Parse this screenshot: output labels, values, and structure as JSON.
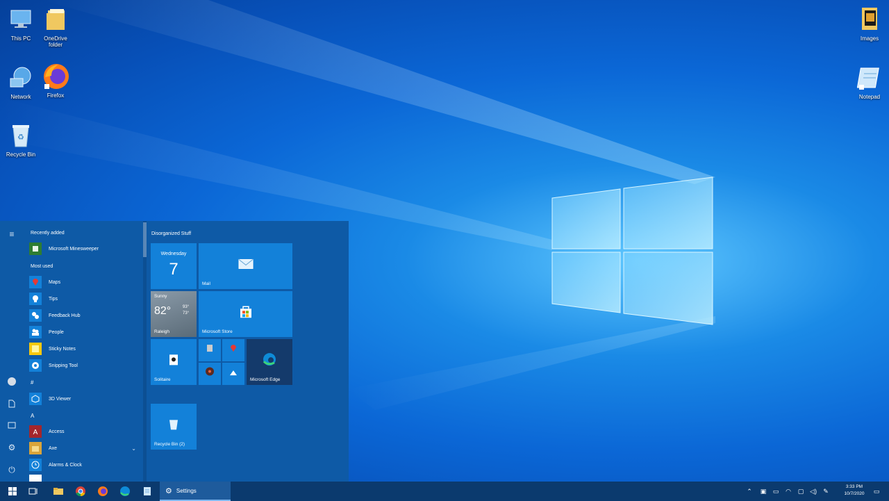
{
  "desktop": {
    "icons_left": [
      {
        "name": "this-pc",
        "label": "This PC"
      },
      {
        "name": "onedrive",
        "label": "OneDrive\nfolder"
      },
      {
        "name": "network",
        "label": "Network"
      },
      {
        "name": "firefox",
        "label": "Firefox"
      },
      {
        "name": "recycle-bin",
        "label": "Recycle Bin"
      }
    ],
    "icons_right": [
      {
        "name": "images",
        "label": "Images"
      },
      {
        "name": "notepad",
        "label": "Notepad"
      }
    ]
  },
  "start_menu": {
    "recently_added_header": "Recently added",
    "most_used_header": "Most used",
    "letter_hash": "#",
    "letter_a": "A",
    "apps": {
      "minesweeper": "Microsoft Minesweeper",
      "maps": "Maps",
      "tips": "Tips",
      "feedback_hub": "Feedback Hub",
      "people": "People",
      "sticky_notes": "Sticky Notes",
      "snipping_tool": "Snipping Tool",
      "viewer_3d": "3D Viewer",
      "access": "Access",
      "axe": "Axe",
      "alarms": "Alarms & Clock"
    },
    "tiles": {
      "group_title": "Disorganized Stuff",
      "calendar_day": "Wednesday",
      "calendar_date": "7",
      "mail": "Mail",
      "weather_cond": "Sunny",
      "weather_temp": "82°",
      "weather_hi": "93°",
      "weather_lo": "73°",
      "weather_city": "Raleigh",
      "store": "Microsoft Store",
      "solitaire": "Solitaire",
      "edge": "Microsoft Edge",
      "recycle": "Recycle Bin (2)"
    }
  },
  "taskbar": {
    "settings_label": "Settings",
    "time": "3:33 PM",
    "date": "10/7/2020"
  },
  "colors": {
    "accent": "#1381d9",
    "start_bg": "#0e5aa6",
    "taskbar": "#0b3a6e"
  }
}
